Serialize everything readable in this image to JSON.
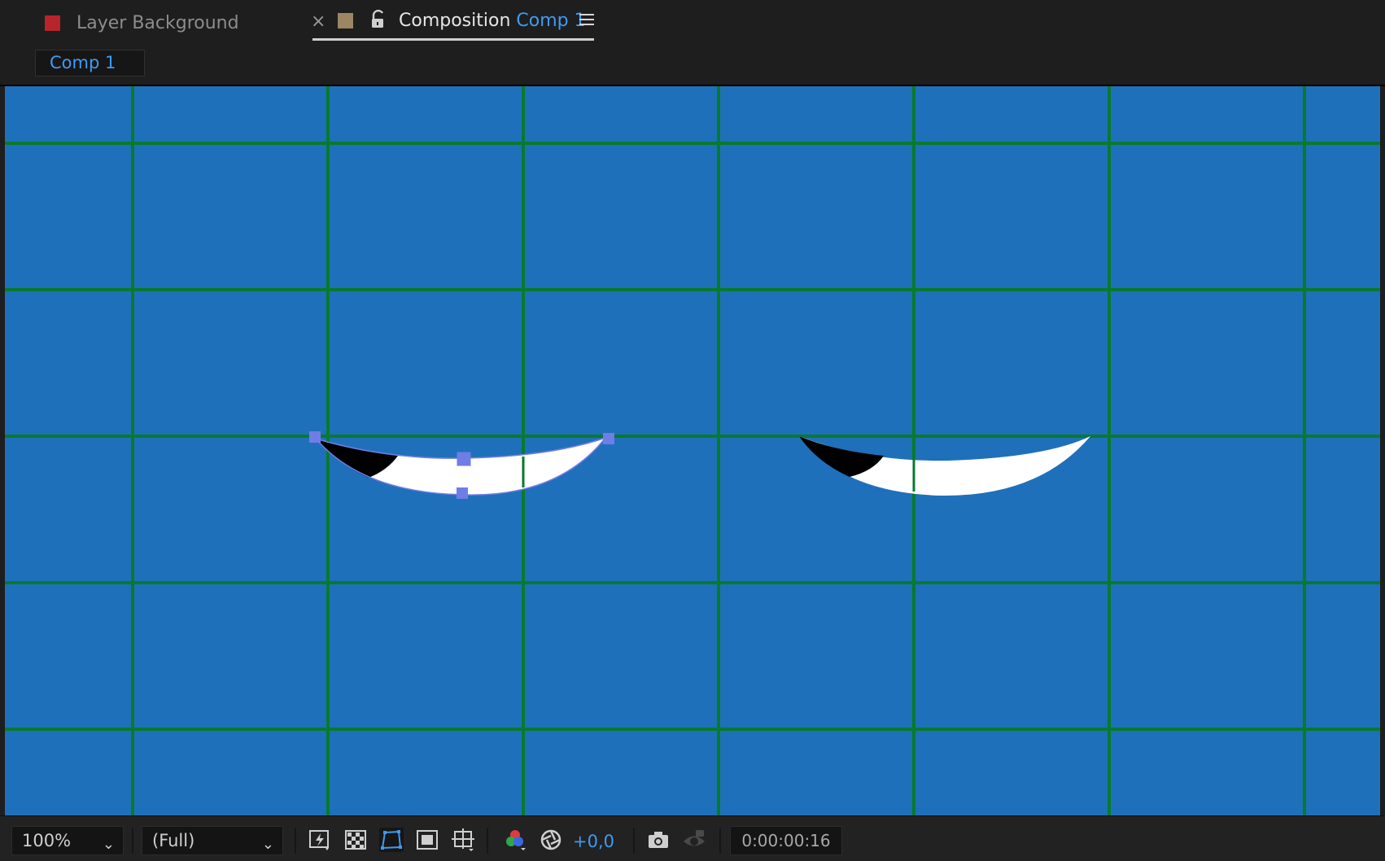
{
  "tabs": {
    "layer_tab": {
      "label": "Layer Background",
      "color": "#b8242b"
    },
    "composition_tab": {
      "prefix": "Composition",
      "name": "Comp 1",
      "color": "#9c8664",
      "close_glyph": "×"
    }
  },
  "breadcrumb": {
    "label": "Comp 1"
  },
  "viewer": {
    "background_color": "#1f70ba",
    "grid_color": "#087a2c",
    "grid": true
  },
  "bottom_toolbar": {
    "zoom": "100%",
    "resolution": "(Full)",
    "exposure": "+0,0",
    "timecode": "0:00:00:16",
    "icons": [
      "fast-previews-icon",
      "transparency-grid-icon",
      "mask-path-visibility-icon",
      "region-of-interest-icon",
      "grid-guides-icon",
      "color-channels-icon",
      "exposure-icon",
      "snapshot-icon",
      "show-snapshot-icon"
    ]
  }
}
